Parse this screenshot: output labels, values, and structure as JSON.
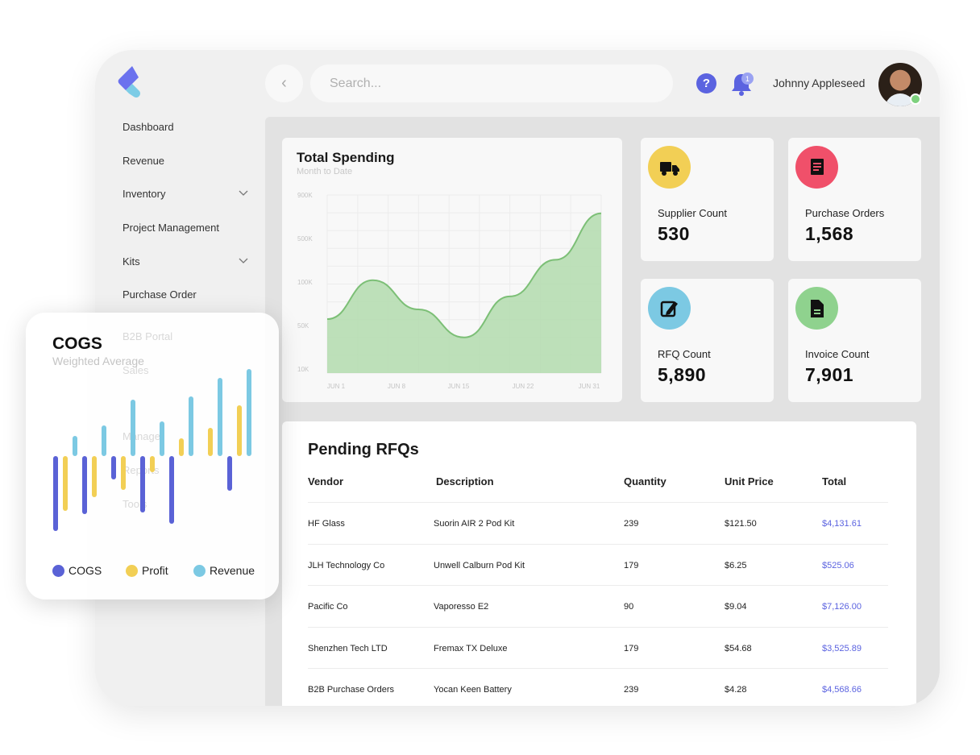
{
  "header": {
    "search_placeholder": "Search...",
    "notification_count": "1",
    "username": "Johnny Appleseed"
  },
  "sidebar": {
    "items": [
      {
        "label": "Dashboard",
        "has_chevron": false
      },
      {
        "label": "Revenue",
        "has_chevron": false
      },
      {
        "label": "Inventory",
        "has_chevron": true
      },
      {
        "label": "Project Management",
        "has_chevron": false
      },
      {
        "label": "Kits",
        "has_chevron": true
      },
      {
        "label": "Purchase Order",
        "has_chevron": false
      }
    ]
  },
  "spending": {
    "title": "Total Spending",
    "subtitle": "Month to Date"
  },
  "stats": [
    {
      "label": "Supplier Count",
      "value": "530",
      "color": "#f2cf55",
      "icon": "truck-icon"
    },
    {
      "label": "Purchase Orders",
      "value": "1,568",
      "color": "#f0506a",
      "icon": "receipt-icon"
    },
    {
      "label": "RFQ Count",
      "value": "5,890",
      "color": "#7cc9e3",
      "icon": "edit-icon"
    },
    {
      "label": "Invoice Count",
      "value": "7,901",
      "color": "#8fd28e",
      "icon": "document-icon"
    }
  ],
  "rfqs": {
    "title": "Pending RFQs",
    "columns": [
      "Vendor",
      "Description",
      "Quantity",
      "Unit Price",
      "Total"
    ],
    "rows": [
      [
        "HF Glass",
        "Suorin AIR 2 Pod Kit",
        "239",
        "$121.50",
        "$4,131.61"
      ],
      [
        "JLH Technology Co",
        "Unwell Calburn Pod Kit",
        "179",
        "$6.25",
        "$525.06"
      ],
      [
        "Pacific Co",
        "Vaporesso E2",
        "90",
        "$9.04",
        "$7,126.00"
      ],
      [
        "Shenzhen Tech LTD",
        "Fremax TX Deluxe",
        "179",
        "$54.68",
        "$3,525.89"
      ],
      [
        "B2B Purchase Orders",
        "Yocan Keen Battery",
        "239",
        "$4.28",
        "$4,568.66"
      ]
    ]
  },
  "cogs": {
    "title": "COGS",
    "subtitle": "Weighted Average",
    "legend": [
      {
        "label": "COGS",
        "color": "#5a62d6"
      },
      {
        "label": "Profit",
        "color": "#f2cf55"
      },
      {
        "label": "Revenue",
        "color": "#7cc9e3"
      }
    ]
  },
  "ghost_text": [
    "B2B Portal",
    "Sales",
    "Manage",
    "Reports",
    "Tools"
  ],
  "chart_data": [
    {
      "type": "area",
      "title": "Total Spending",
      "subtitle": "Month to Date",
      "x_ticks": [
        "JUN 1",
        "JUN 8",
        "JUN 15",
        "JUN 22",
        "JUN 31"
      ],
      "y_ticks": [
        "900K",
        "500K",
        "100K",
        "50K",
        "10K"
      ],
      "series": [
        {
          "values": [
            0.5,
            0.86,
            0.59,
            0.33,
            0.71,
            1.05,
            1.48
          ]
        }
      ],
      "color": "#b3dcae",
      "line_color": "#7cbf76",
      "grid": true
    },
    {
      "type": "bar",
      "title": "COGS",
      "subtitle": "Weighted Average",
      "series": [
        {
          "name": "COGS",
          "values": [
            -93,
            -72,
            -29,
            -70,
            -84,
            -43
          ]
        },
        {
          "name": "Profit",
          "values": [
            -68,
            -51,
            -42,
            -20,
            22,
            35,
            63
          ]
        },
        {
          "name": "Revenue",
          "values": [
            25,
            38,
            70,
            43,
            74,
            97,
            108
          ]
        }
      ]
    }
  ]
}
